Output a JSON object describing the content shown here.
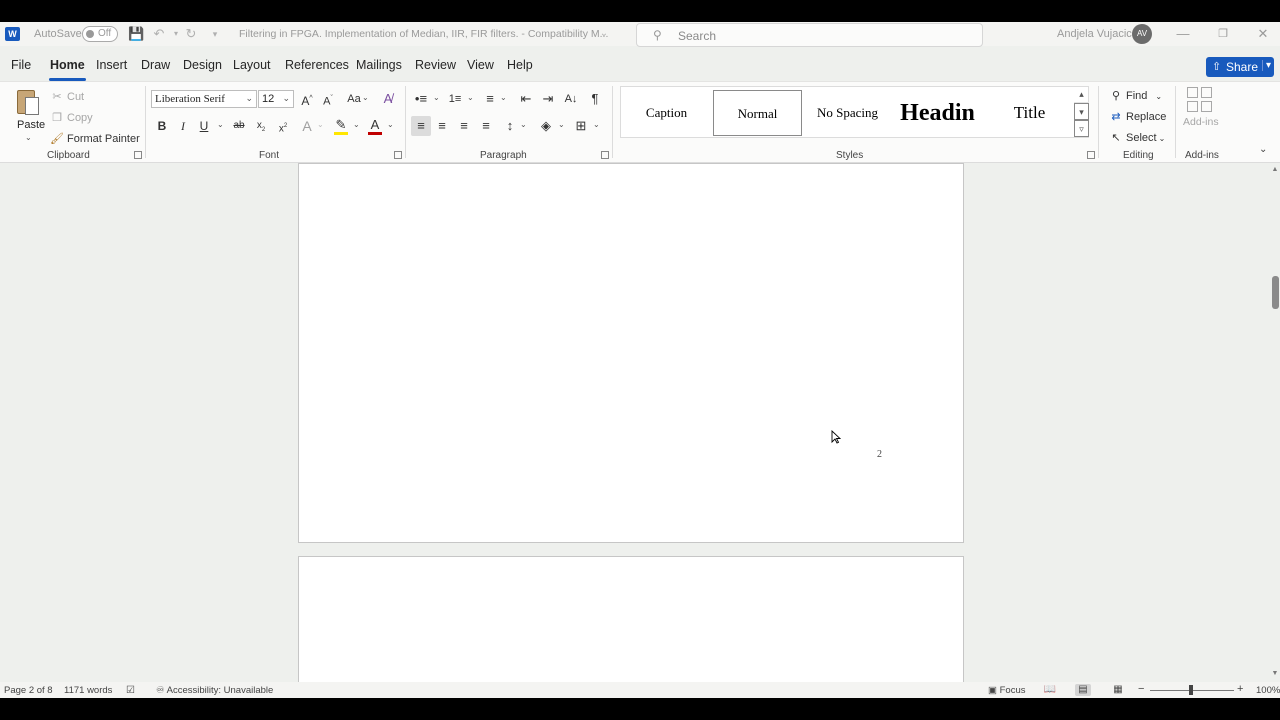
{
  "titlebar": {
    "app_logo": "W",
    "autosave_label": "AutoSave",
    "autosave_state": "Off",
    "doc_title": "Filtering in FPGA. Implementation of Median, IIR, FIR filters.  -  Compatibility M...",
    "search_placeholder": "Search",
    "user_name": "Andjela Vujacic",
    "user_initials": "AV"
  },
  "tabs": [
    {
      "label": "File"
    },
    {
      "label": "Home"
    },
    {
      "label": "Insert"
    },
    {
      "label": "Draw"
    },
    {
      "label": "Design"
    },
    {
      "label": "Layout"
    },
    {
      "label": "References"
    },
    {
      "label": "Mailings"
    },
    {
      "label": "Review"
    },
    {
      "label": "View"
    },
    {
      "label": "Help"
    }
  ],
  "share_label": "Share",
  "clipboard": {
    "paste": "Paste",
    "cut": "Cut",
    "copy": "Copy",
    "format_painter": "Format Painter",
    "group_label": "Clipboard"
  },
  "font": {
    "family": "Liberation Serif",
    "size": "12",
    "group_label": "Font",
    "bold": "B",
    "italic": "I",
    "underline": "U",
    "strike": "ab",
    "change_case": "Aa"
  },
  "paragraph": {
    "group_label": "Paragraph"
  },
  "styles": {
    "items": [
      {
        "label": "Caption"
      },
      {
        "label": "Normal"
      },
      {
        "label": "No Spacing"
      },
      {
        "label": "Headin"
      },
      {
        "label": "Title"
      }
    ],
    "group_label": "Styles"
  },
  "editing": {
    "find": "Find",
    "replace": "Replace",
    "select": "Select",
    "group_label": "Editing"
  },
  "addins": {
    "button": "Add-ins",
    "group_label": "Add-ins"
  },
  "document": {
    "page_number": "2"
  },
  "statusbar": {
    "page": "Page 2 of 8",
    "words": "1171 words",
    "accessibility": "Accessibility: Unavailable",
    "focus": "Focus",
    "zoom": "100%"
  },
  "colors": {
    "accent": "#185abd",
    "highlight": "#ffe600",
    "font_color": "#c00000",
    "canvas": "#eef0ed"
  }
}
